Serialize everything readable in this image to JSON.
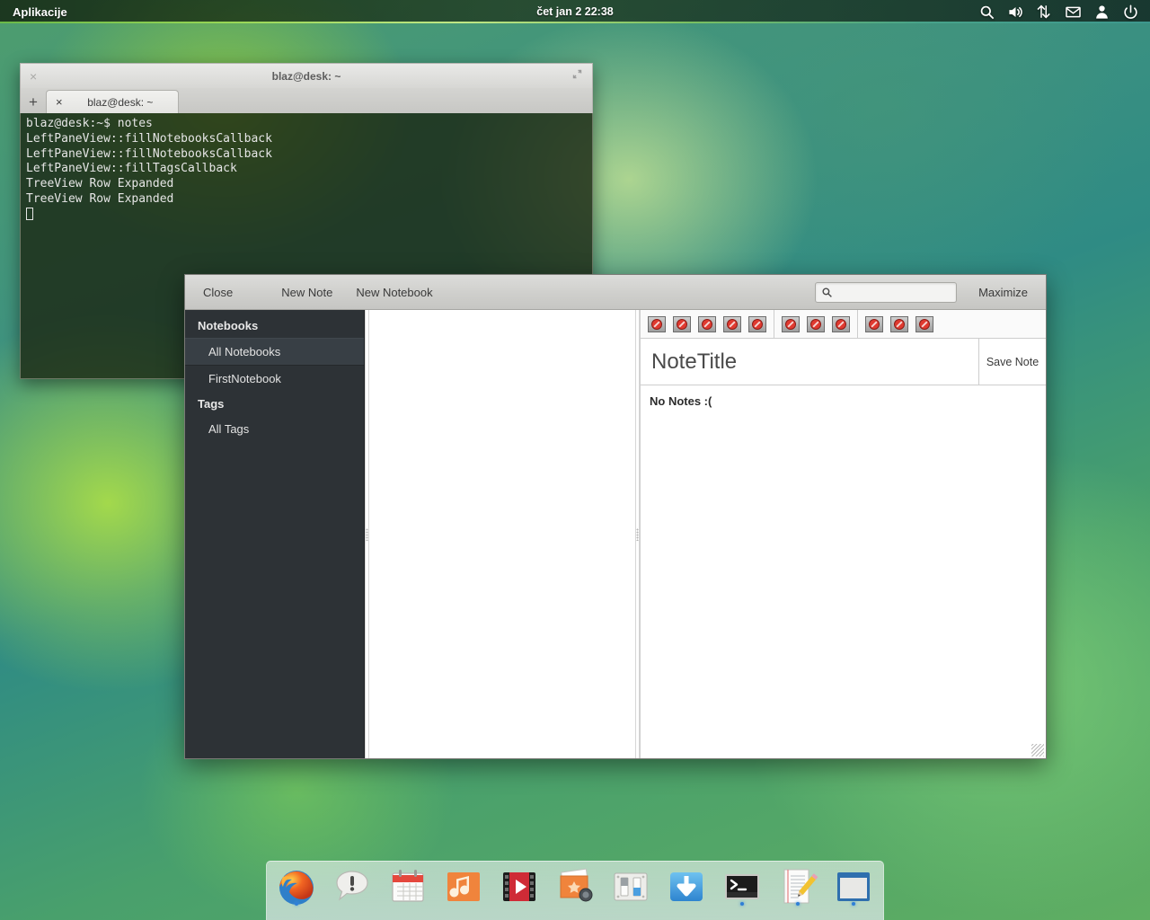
{
  "panel": {
    "applications_label": "Aplikacije",
    "clock": "čet jan  2 22:38",
    "tray": [
      {
        "name": "search-icon",
        "label": "Search"
      },
      {
        "name": "volume-icon",
        "label": "Volume"
      },
      {
        "name": "network-icon",
        "label": "Network"
      },
      {
        "name": "mail-icon",
        "label": "Mail"
      },
      {
        "name": "user-icon",
        "label": "User"
      },
      {
        "name": "power-icon",
        "label": "Power"
      }
    ]
  },
  "terminal": {
    "title": "blaz@desk: ~",
    "close_label": "×",
    "maximize_label": "⤢",
    "new_tab_label": "+",
    "tab": {
      "label": "blaz@desk: ~",
      "close_label": "×"
    },
    "lines": [
      "blaz@desk:~$ notes",
      "LeftPaneView::fillNotebooksCallback",
      "LeftPaneView::fillNotebooksCallback",
      "LeftPaneView::fillTagsCallback",
      "TreeView Row Expanded",
      "TreeView Row Expanded"
    ]
  },
  "notes_app": {
    "toolbar": {
      "close_label": "Close",
      "new_note_label": "New Note",
      "new_notebook_label": "New Notebook",
      "maximize_label": "Maximize",
      "search": {
        "value": "",
        "placeholder": "",
        "icon": "search-icon"
      }
    },
    "sidebar": {
      "notebooks_header": "Notebooks",
      "notebooks": [
        {
          "label": "All Notebooks",
          "selected": true
        },
        {
          "label": "FirstNotebook",
          "selected": false
        }
      ],
      "tags_header": "Tags",
      "tags": [
        {
          "label": "All Tags",
          "selected": false
        }
      ]
    },
    "editor": {
      "icon_groups": [
        [
          "image-missing-icon",
          "image-missing-icon",
          "image-missing-icon",
          "image-missing-icon",
          "image-missing-icon"
        ],
        [
          "image-missing-icon",
          "image-missing-icon",
          "image-missing-icon"
        ],
        [
          "image-missing-icon",
          "image-missing-icon",
          "image-missing-icon"
        ]
      ],
      "title_value": "NoteTitle",
      "title_placeholder": "NoteTitle",
      "save_label": "Save Note",
      "body_text": "No Notes :("
    }
  },
  "dock": {
    "items": [
      {
        "name": "firefox-icon",
        "label": "Firefox",
        "running": true
      },
      {
        "name": "messaging-icon",
        "label": "Messaging",
        "running": false
      },
      {
        "name": "calendar-icon",
        "label": "Calendar",
        "running": false
      },
      {
        "name": "music-icon",
        "label": "Music",
        "running": false
      },
      {
        "name": "video-icon",
        "label": "Videos",
        "running": false
      },
      {
        "name": "photos-icon",
        "label": "Photos",
        "running": false
      },
      {
        "name": "settings-icon",
        "label": "System Settings",
        "running": false
      },
      {
        "name": "downloads-icon",
        "label": "Downloads",
        "running": false
      },
      {
        "name": "terminal-icon",
        "label": "Terminal",
        "running": true
      },
      {
        "name": "text-editor-icon",
        "label": "Text Editor",
        "running": true
      },
      {
        "name": "notes-app-icon",
        "label": "Notes",
        "running": true
      }
    ]
  },
  "colors": {
    "panel_accent": "#9ede58",
    "sidebar_bg": "#2d3236",
    "sidebar_selected_bg": "#383f45",
    "missing_icon_red": "#e03a30",
    "running_dot": "#2f7fd6"
  }
}
